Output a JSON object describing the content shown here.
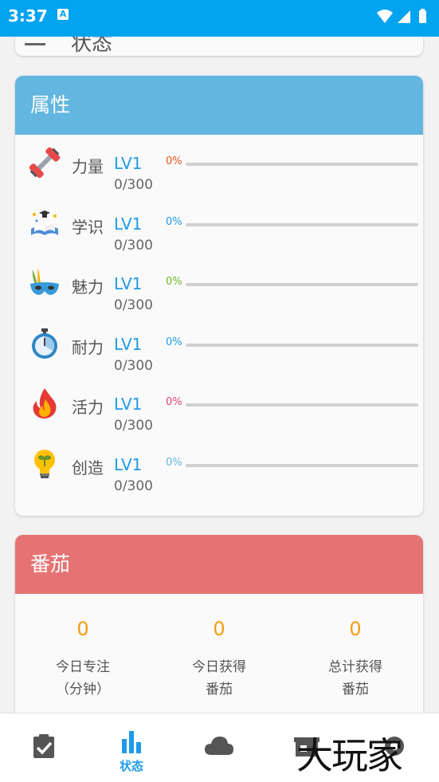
{
  "status_bar": {
    "time": "3:37",
    "app_icon_letter": "A"
  },
  "previous_card": {
    "title": "状态"
  },
  "attributes": {
    "title": "属性",
    "header_color": "#62b6e0",
    "items": [
      {
        "name": "力量",
        "level": "LV1",
        "progress": "0/300",
        "percent": "0%",
        "percent_value": 0,
        "color": "#e8541c",
        "icon": "dumbbell-icon"
      },
      {
        "name": "学识",
        "level": "LV1",
        "progress": "0/300",
        "percent": "0%",
        "percent_value": 0,
        "color": "#1e9be8",
        "icon": "book-icon"
      },
      {
        "name": "魅力",
        "level": "LV1",
        "progress": "0/300",
        "percent": "0%",
        "percent_value": 0,
        "color": "#74b52a",
        "icon": "mask-icon"
      },
      {
        "name": "耐力",
        "level": "LV1",
        "progress": "0/300",
        "percent": "0%",
        "percent_value": 0,
        "color": "#1e9be8",
        "icon": "stopwatch-icon"
      },
      {
        "name": "活力",
        "level": "LV1",
        "progress": "0/300",
        "percent": "0%",
        "percent_value": 0,
        "color": "#e83c7a",
        "icon": "flame-icon"
      },
      {
        "name": "创造",
        "level": "LV1",
        "progress": "0/300",
        "percent": "0%",
        "percent_value": 0,
        "color": "#62b6e0",
        "icon": "lightbulb-icon"
      }
    ]
  },
  "tomato": {
    "title": "番茄",
    "header_color": "#e57373",
    "stats": [
      {
        "value": "0",
        "label": "今日专注\n（分钟）"
      },
      {
        "value": "0",
        "label": "今日获得\n番茄"
      },
      {
        "value": "0",
        "label": "总计获得\n番茄"
      }
    ]
  },
  "nav": {
    "active_color": "#1e9be8",
    "items": [
      {
        "icon": "clipboard-check-icon",
        "label": ""
      },
      {
        "icon": "bar-chart-icon",
        "label": "状态"
      },
      {
        "icon": "cloud-icon",
        "label": ""
      },
      {
        "icon": "store-icon",
        "label": ""
      },
      {
        "icon": "settings-icon",
        "label": ""
      }
    ]
  },
  "watermark": "大玩家"
}
